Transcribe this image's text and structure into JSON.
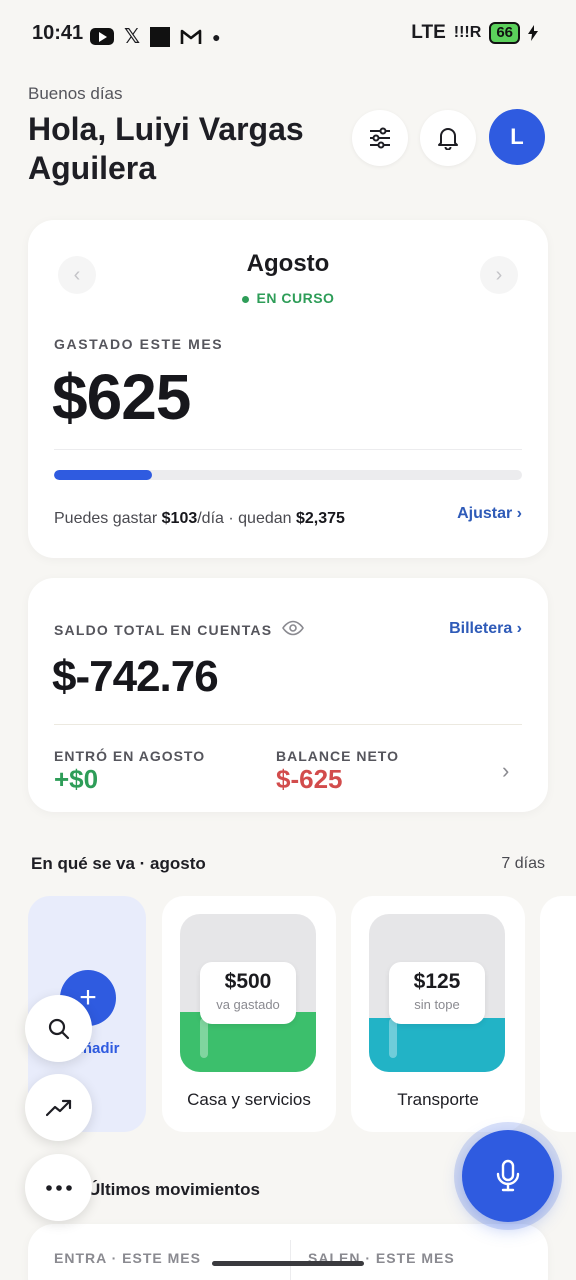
{
  "status_bar": {
    "time": "10:41",
    "network": "LTE",
    "signal": "!!!R",
    "battery": "66",
    "icons": [
      "youtube-icon",
      "x-icon",
      "app-square-icon",
      "gmail-icon",
      "dot-icon",
      "charging-icon"
    ]
  },
  "header": {
    "greeting": "Buenos días",
    "name": "Hola, Luiyi Vargas Aguilera",
    "avatar_initial": "L"
  },
  "month_card": {
    "month": "Agosto",
    "status": "EN CURSO",
    "spent_label": "GASTADO ESTE MES",
    "spent_value": "$625",
    "progress_fraction": 0.21,
    "can_spend_prefix": "Puedes gastar",
    "per_day": "$103",
    "per_day_suffix": "/día · quedan",
    "remaining": "$2,375",
    "adjust_link": "Ajustar ›"
  },
  "balance_card": {
    "label": "SALDO TOTAL EN CUENTAS",
    "wallet_link": "Billetera ›",
    "total": "$-742.76",
    "in_label": "ENTRÓ EN AGOSTO",
    "in_value": "+$0",
    "net_label": "BALANCE NETO",
    "net_value": "$-625"
  },
  "categories_section": {
    "title": "En qué se va · agosto",
    "days": "7 días",
    "add_label": "Añadir",
    "items": [
      {
        "name": "Casa y servicios",
        "amount": "$500",
        "note": "va gastado",
        "fill_fraction": 0.38,
        "color": "#3cbf6c"
      },
      {
        "name": "Transporte",
        "amount": "$125",
        "note": "sin tope",
        "fill_fraction": 0.34,
        "color": "#22b3c6"
      }
    ]
  },
  "movements": {
    "title": "Últimos movimientos",
    "in_label": "ENTRA · ESTE MES",
    "out_label": "SALEN · ESTE MES"
  },
  "colors": {
    "accent": "#2f5be0",
    "positive": "#2e9d58",
    "negative": "#d24c4c"
  }
}
